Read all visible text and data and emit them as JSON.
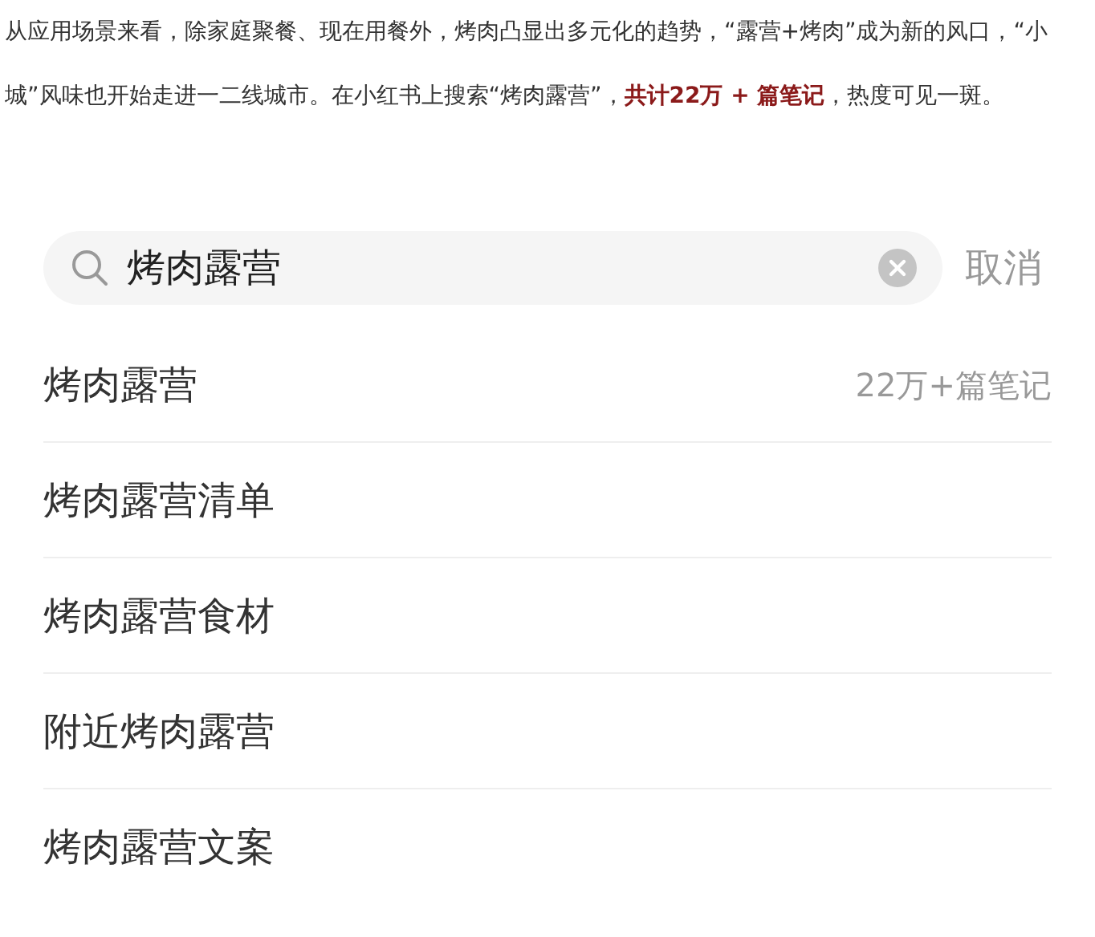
{
  "article": {
    "paragraph": "从应用场景来看，除家庭聚餐、现在用餐外，烤肉凸显出多元化的趋势，“露营+烤肉”成为新的风口，“小城”风味也开始走进一二线城市。在小红书上搜索“烤肉露营”，**共计22万 + 篇笔记**，热度可见一斑。"
  },
  "search": {
    "value": "烤肉露营",
    "cancel": "取消"
  },
  "suggestions": [
    {
      "text": "烤肉露营",
      "count": "22万+篇笔记"
    },
    {
      "text": "烤肉露营清单"
    },
    {
      "text": "烤肉露营食材"
    },
    {
      "text": "附近烤肉露营"
    },
    {
      "text": "烤肉露营文案"
    }
  ]
}
